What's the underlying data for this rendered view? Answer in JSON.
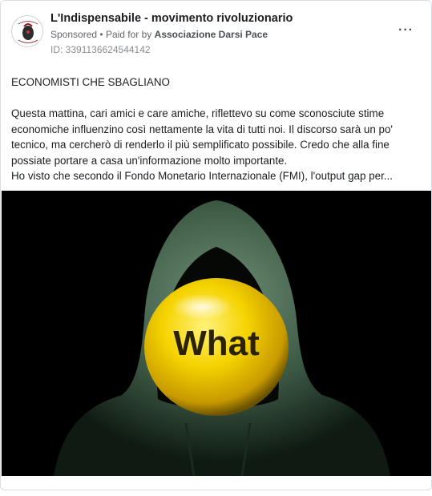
{
  "ad": {
    "page_name": "L'Indispensabile - movimento rivoluzionario",
    "sponsored_label": "Sponsored",
    "separator": "•",
    "paid_for_label": "Paid for by",
    "payer": "Associazione Darsi Pace",
    "id_text": "ID: 3391136624544142",
    "more_label": "···",
    "headline": "ECONOMISTI CHE SBAGLIANO",
    "body_lines": [
      "Questa mattina, cari amici e care amiche, riflettevo su come sconosciute stime",
      "economiche influenzino così nettamente la vita di tutti noi. Il discorso sarà un po'",
      "tecnico, ma cercherò di renderlo il più semplificato possibile. Credo che alla fine",
      "possiate portare a casa un'informazione molto importante.",
      "Ho visto che secondo il Fondo Monetario Internazionale (FMI), l'output gap per..."
    ],
    "image": {
      "ball_text": "What",
      "colors": {
        "ball": "#f5d300",
        "hoodie": "#3d5a45",
        "background": "#000000"
      }
    }
  }
}
